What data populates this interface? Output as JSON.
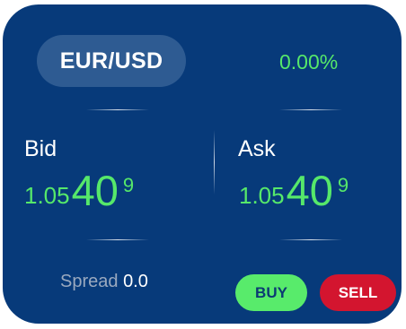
{
  "ticker": {
    "pair": "EUR/USD",
    "change": "0.00%",
    "bid": {
      "label": "Bid",
      "price_prefix": "1.05",
      "price_big": "40",
      "price_pip": "9"
    },
    "ask": {
      "label": "Ask",
      "price_prefix": "1.05",
      "price_big": "40",
      "price_pip": "9"
    },
    "spread": {
      "label": "Spread",
      "value": "0.0"
    },
    "buttons": {
      "buy_label": "BUY",
      "sell_label": "SELL"
    },
    "colors": {
      "background": "#073a7a",
      "pill": "#2e5b92",
      "price_green": "#56e86a",
      "buy": "#58eb6b",
      "sell": "#d3152f"
    }
  }
}
